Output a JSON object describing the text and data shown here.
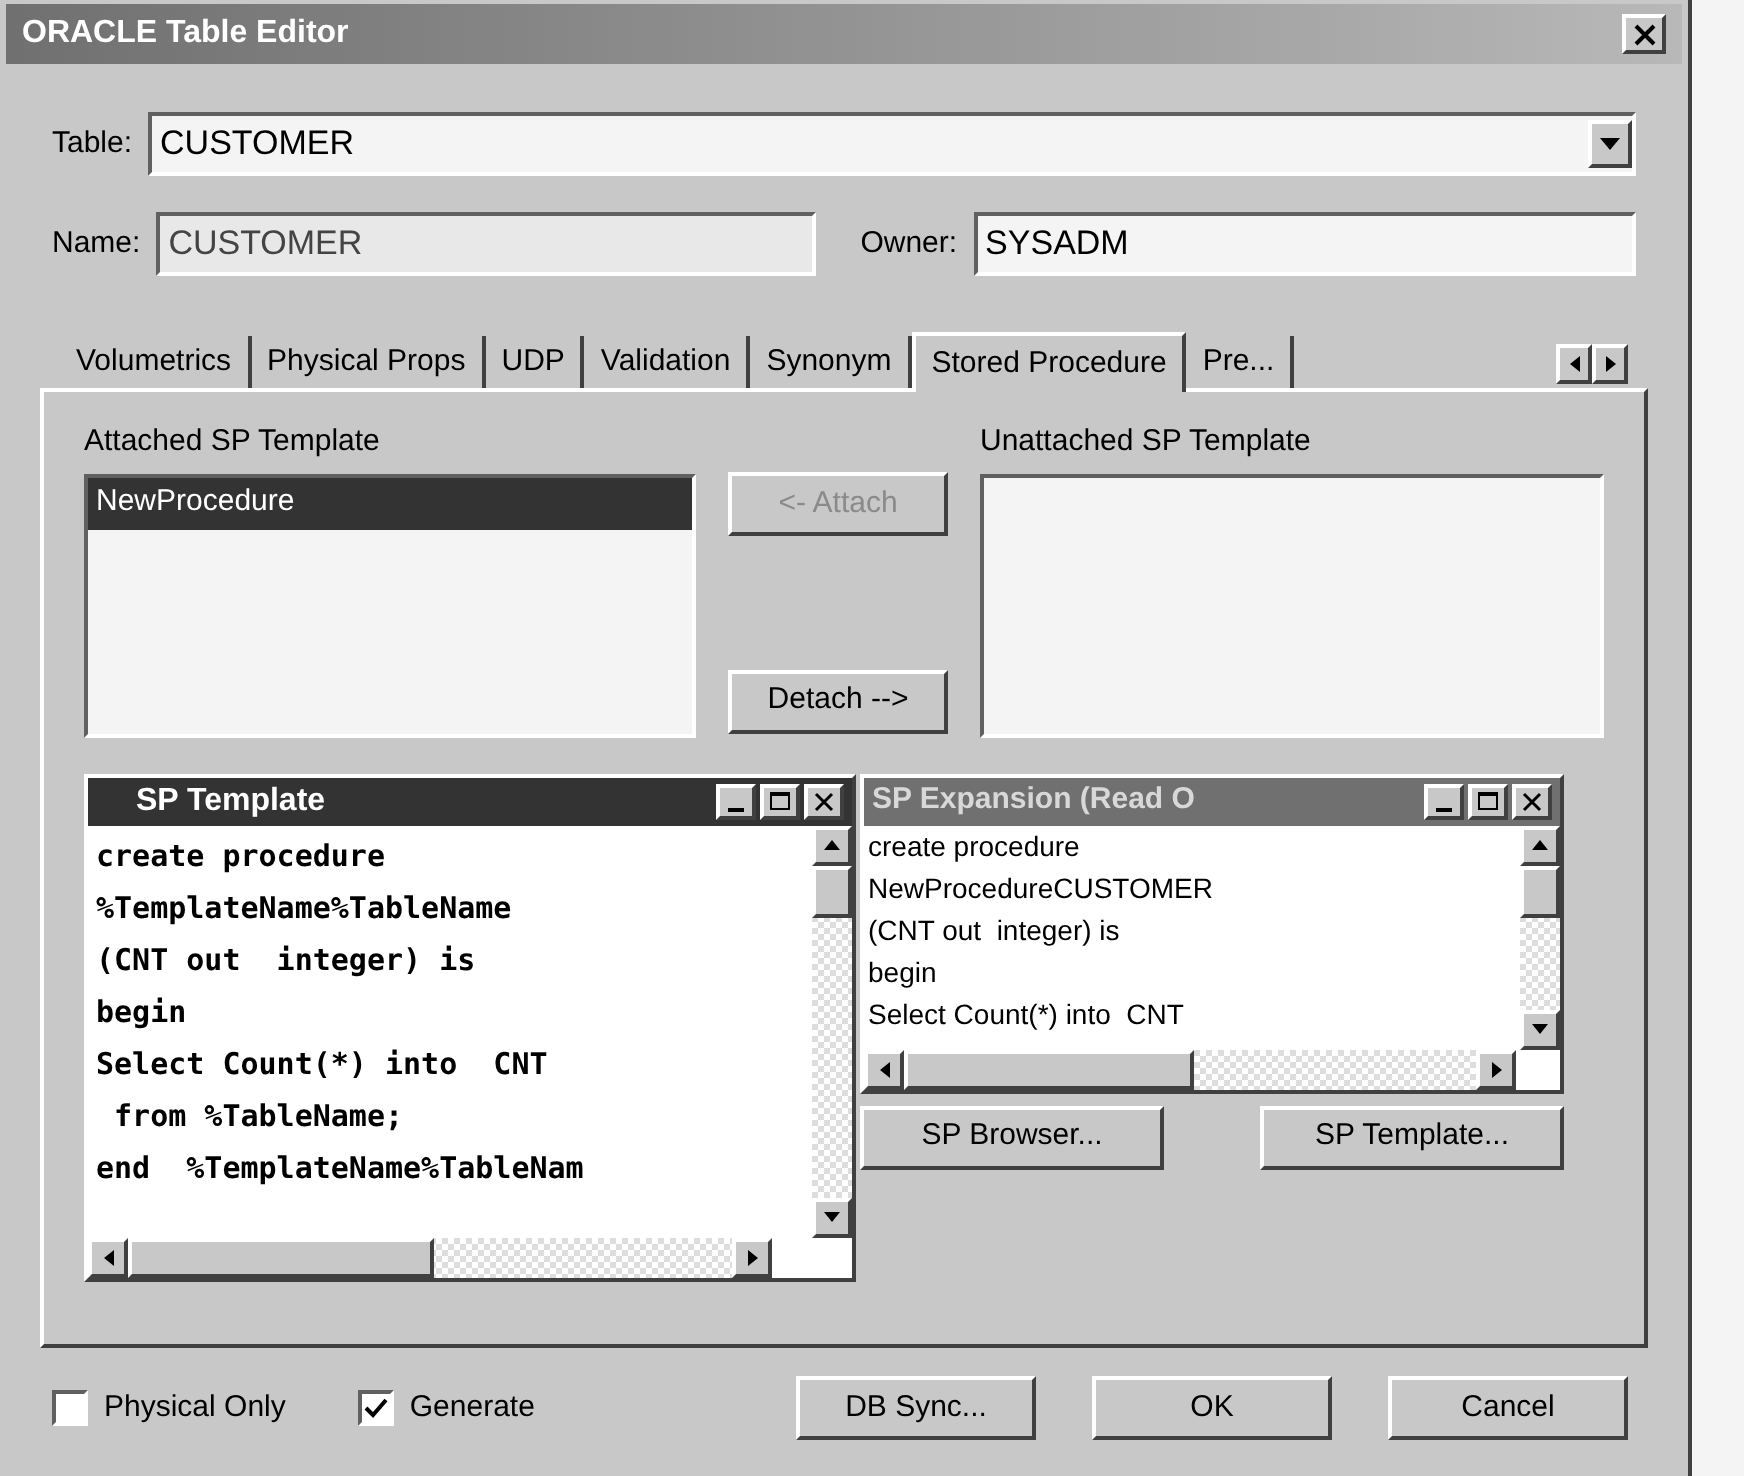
{
  "window": {
    "title": "ORACLE Table Editor"
  },
  "table_field": {
    "label": "Table:",
    "value": "CUSTOMER"
  },
  "name_field": {
    "label": "Name:",
    "value": "CUSTOMER"
  },
  "owner_field": {
    "label": "Owner:",
    "value": "SYSADM"
  },
  "tabs": [
    {
      "label": "Volumetrics",
      "selected": false
    },
    {
      "label": "Physical Props",
      "selected": false
    },
    {
      "label": "UDP",
      "selected": false
    },
    {
      "label": "Validation",
      "selected": false
    },
    {
      "label": "Synonym",
      "selected": false
    },
    {
      "label": "Stored Procedure",
      "selected": true
    },
    {
      "label": "Pre...",
      "selected": false
    }
  ],
  "attached": {
    "label": "Attached SP Template",
    "items": [
      {
        "label": "NewProcedure",
        "selected": true
      }
    ]
  },
  "unattached": {
    "label": "Unattached SP Template"
  },
  "attach_button": {
    "label": "<- Attach",
    "disabled": true
  },
  "detach_button": {
    "label": "Detach -->",
    "disabled": false
  },
  "template_window": {
    "title": "SP Template",
    "lines": [
      "create procedure",
      "%TemplateName%TableName",
      "(CNT out  integer) is",
      "begin",
      "Select Count(*) into  CNT",
      " from %TableName;",
      "end  %TemplateName%TableNam"
    ]
  },
  "expansion_window": {
    "title": "SP Expansion (Read O",
    "lines": [
      "create procedure",
      "NewProcedureCUSTOMER",
      "(CNT out  integer) is",
      "begin",
      "Select Count(*) into  CNT"
    ]
  },
  "panel_buttons": [
    "SP Browser...",
    "SP Template..."
  ],
  "checkboxes": [
    {
      "label": "Physical Only",
      "checked": false
    },
    {
      "label": "Generate",
      "checked": true
    }
  ],
  "buttons": [
    "DB Sync...",
    "OK",
    "Cancel"
  ]
}
